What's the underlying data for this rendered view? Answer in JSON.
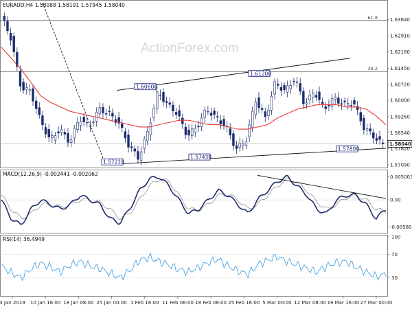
{
  "chart_data": [
    {
      "type": "candlestick",
      "title": "EURAUD,H4  1.58088 1.58191 1.57945 1.58040",
      "watermark": "ActionForex.com",
      "ylim": [
        1.57,
        1.644
      ],
      "y_ticks": [
        "1.63640",
        "1.62910",
        "1.62180",
        "1.61450",
        "1.60720",
        "1.60000",
        "1.59260",
        "1.58540",
        "1.57820",
        "1.57090"
      ],
      "last_price": "1.58040",
      "fib_levels": [
        {
          "label": "61.8",
          "value": 1.636
        },
        {
          "label": "38.2",
          "value": 1.613
        }
      ],
      "level_labels": [
        {
          "text": "1.60600",
          "value": 1.606,
          "anchor": "2019-01-27"
        },
        {
          "text": "1.61200",
          "value": 1.612,
          "anchor": "2019-03-03"
        },
        {
          "text": "1.57210",
          "value": 1.5721,
          "anchor": "2019-01-30"
        },
        {
          "text": "1.57430",
          "value": 1.5743,
          "anchor": "2019-02-18"
        },
        {
          "text": "1.57800",
          "value": 1.578,
          "anchor": "2019-03-25"
        }
      ],
      "price_path": [
        1.638,
        1.628,
        1.606,
        1.604,
        1.591,
        1.582,
        1.587,
        1.581,
        1.592,
        1.588,
        1.596,
        1.594,
        1.59,
        1.58,
        1.574,
        1.586,
        1.604,
        1.598,
        1.594,
        1.584,
        1.588,
        1.596,
        1.592,
        1.588,
        1.578,
        1.582,
        1.6,
        1.592,
        1.608,
        1.604,
        1.61,
        1.598,
        1.604,
        1.596,
        1.601,
        1.598,
        1.599,
        1.588,
        1.584,
        1.58
      ],
      "ma_path": [
        1.624,
        1.619,
        1.614,
        1.608,
        1.602,
        1.599,
        1.597,
        1.595,
        1.594,
        1.593,
        1.592,
        1.591,
        1.59,
        1.589,
        1.588,
        1.588,
        1.589,
        1.59,
        1.591,
        1.591,
        1.59,
        1.589,
        1.589,
        1.588,
        1.587,
        1.587,
        1.588,
        1.589,
        1.592,
        1.594,
        1.596,
        1.597,
        1.598,
        1.598,
        1.598,
        1.597,
        1.597,
        1.596,
        1.593,
        1.589
      ],
      "colors": {
        "price": "#1c2c6c",
        "ma": "#e53935",
        "trendline": "#111111",
        "label_border": "#1a237e"
      }
    },
    {
      "type": "line",
      "title": "MACD(12,26,9) -0.002441 -0.002062",
      "ylim": [
        -0.0068,
        0.0058
      ],
      "y_ticks": [
        "0.005003",
        "0.00",
        "-0.005801"
      ],
      "macd": [
        0.0,
        -0.004,
        -0.0055,
        -0.002,
        0.0,
        -0.001,
        -0.002,
        -0.001,
        0.001,
        0.0,
        -0.001,
        -0.004,
        -0.005,
        -0.002,
        0.002,
        0.0045,
        0.005,
        0.003,
        0.0,
        -0.003,
        -0.002,
        0.0,
        0.002,
        0.001,
        -0.001,
        -0.003,
        0.0,
        0.002,
        0.004,
        0.005,
        0.003,
        0.001,
        -0.002,
        -0.003,
        0.0,
        0.001,
        0.001,
        -0.001,
        -0.004,
        -0.002
      ],
      "signal": [
        0.001,
        -0.002,
        -0.004,
        -0.003,
        -0.001,
        -0.001,
        -0.0015,
        -0.001,
        0.0,
        0.0,
        -0.0005,
        -0.002,
        -0.004,
        -0.003,
        0.0,
        0.003,
        0.0045,
        0.004,
        0.001,
        -0.002,
        -0.0022,
        -0.001,
        0.001,
        0.0012,
        0.0,
        -0.002,
        -0.001,
        0.001,
        0.003,
        0.0045,
        0.0038,
        0.002,
        -0.0005,
        -0.002,
        -0.001,
        0.0005,
        0.001,
        0.0,
        -0.002,
        -0.0025
      ],
      "colors": {
        "macd": "#1c2c6c",
        "signal": "#9a9a9a",
        "trendline": "#111111"
      }
    },
    {
      "type": "line",
      "title": "RSI(14) 36.4949",
      "ylim": [
        0,
        100
      ],
      "y_ticks": [
        "100",
        "70",
        "30"
      ],
      "rsi": [
        50,
        38,
        30,
        45,
        55,
        48,
        40,
        52,
        58,
        50,
        46,
        38,
        30,
        42,
        60,
        65,
        58,
        52,
        44,
        40,
        48,
        56,
        62,
        50,
        42,
        36,
        52,
        60,
        66,
        58,
        52,
        46,
        40,
        50,
        56,
        58,
        48,
        40,
        32,
        36
      ],
      "x_labels": [
        "3 Jan 2019",
        "10 Jan 16:00",
        "18 Jan 08:00",
        "25 Jan 00:00",
        "1 Feb 16:00",
        "11 Feb 08:00",
        "18 Feb 08:00",
        "25 Feb 16:00",
        "5 Mar 00:00",
        "12 Mar 08:00",
        "19 Mar 16:00",
        "27 Mar 00:00"
      ],
      "colors": {
        "rsi": "#4aa3df"
      }
    }
  ]
}
